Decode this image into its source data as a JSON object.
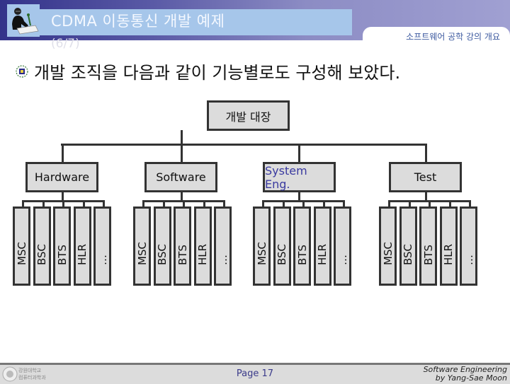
{
  "header": {
    "title": "CDMA 이동통신 개발 예제",
    "title_suffix": "(6/7)",
    "course_label": "소프트웨어 공학 강의 개요",
    "icon": "teacher-at-desk-icon"
  },
  "heading": {
    "bullet_icon": "ornament-bullet-icon",
    "text": "개발 조직을 다음과 같이 기능별로도 구성해 보았다."
  },
  "org_chart": {
    "root": "개발 대장",
    "groups": [
      {
        "label": "Hardware",
        "label_color": "#111111",
        "units": [
          "MSC",
          "BSC",
          "BTS",
          "HLR",
          "…"
        ]
      },
      {
        "label": "Software",
        "label_color": "#111111",
        "units": [
          "MSC",
          "BSC",
          "BTS",
          "HLR",
          "…"
        ]
      },
      {
        "label": "System Eng.",
        "label_color": "#3a3aa0",
        "units": [
          "MSC",
          "BSC",
          "BTS",
          "HLR",
          "…"
        ]
      },
      {
        "label": "Test",
        "label_color": "#111111",
        "units": [
          "MSC",
          "BSC",
          "BTS",
          "HLR",
          "…"
        ]
      }
    ]
  },
  "footer": {
    "logo_icon": "university-seal-icon",
    "logo_text_1": "강원대학교",
    "logo_text_2": "컴퓨터과학과",
    "page": "Page 17",
    "credit_1": "Software Engineering",
    "credit_2": "by Yang-Sae Moon"
  },
  "colors": {
    "header_dark": "#33338a",
    "title_box": "#a6c6ea",
    "box_fill": "#dcdcdc",
    "box_border": "#333333"
  }
}
